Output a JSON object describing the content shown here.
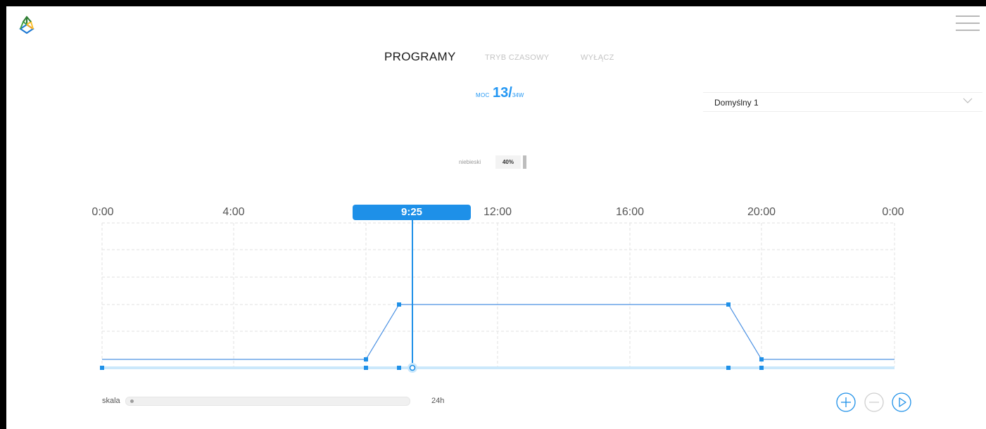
{
  "tabs": [
    {
      "label": "PROGRAMY",
      "active": true
    },
    {
      "label": "TRYB CZASOWY",
      "active": false
    },
    {
      "label": "WYŁĄCZ",
      "active": false
    }
  ],
  "power": {
    "label": "MOC",
    "value": "13",
    "separator": "/",
    "max": "34W"
  },
  "program_select": {
    "selected": "Domyślny 1"
  },
  "channel": {
    "name": "niebieski",
    "percent": "40%"
  },
  "timeline": {
    "ticks": [
      "0:00",
      "4:00",
      "12:00",
      "16:00",
      "20:00",
      "0:00"
    ],
    "current_time": "9:25"
  },
  "scale": {
    "label": "skala",
    "value": "24h"
  },
  "colors": {
    "accent": "#1e90e8",
    "line": "#4a90e2",
    "track": "#cbe8fb",
    "grid": "#e2e2e2"
  },
  "icons": {
    "logo": "cube-logo-icon",
    "menu": "hamburger-menu-icon",
    "add": "plus-circle-icon",
    "remove": "minus-circle-icon",
    "play": "play-circle-icon"
  }
}
